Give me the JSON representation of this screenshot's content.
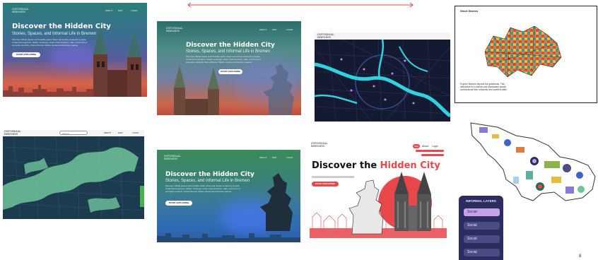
{
  "hero": {
    "title": "Discover the Hidden City",
    "subtitle": "Stories, Spaces, and Informal Life in Bremen",
    "body": "Discover official places and invisible paths. Meet real stories created by people. Understand gardens, hidden meetings, street cultural places, walk, and forms of everyday creativity. Kleine Bremer hidden stories and discover spaces.",
    "cta": "START EXPLORING",
    "logo_line1": "INFORMAL",
    "logo_line2": "BREMEN",
    "nav": [
      "ABOUT",
      "MAP",
      "LOGIN"
    ]
  },
  "red_hero": {
    "logo_line1": "INFORMAL",
    "logo_line2": "BREMEN",
    "title_part1": "Discover the",
    "title_part2": "Hidden City",
    "nav": [
      "Map",
      "About",
      "Login"
    ],
    "cta": "START EXPLORING"
  },
  "short_stories": {
    "title": "Short Stories",
    "caption": "Explore Bremen beyond the guidebook. This interactive tool collects and showcases places contributions from residents and travelers alike."
  },
  "green_map": {
    "logo_line1": "INFORMAL",
    "logo_line2": "BREMEN",
    "search_placeholder": "Search",
    "nav": [
      "ABOUT",
      "MAP",
      "LOGIN"
    ]
  },
  "layers": {
    "title": "INFORMAL LAYERS",
    "items": [
      "Social",
      "Social",
      "Social",
      "Social"
    ]
  },
  "page_number": "8",
  "colors": {
    "accent_red": "#e8474b",
    "layers_panel": "#2d2c5e",
    "layer_active": "#c7a2e8",
    "map_dark": "#151a33",
    "map_cyan": "#2fd3e0"
  }
}
